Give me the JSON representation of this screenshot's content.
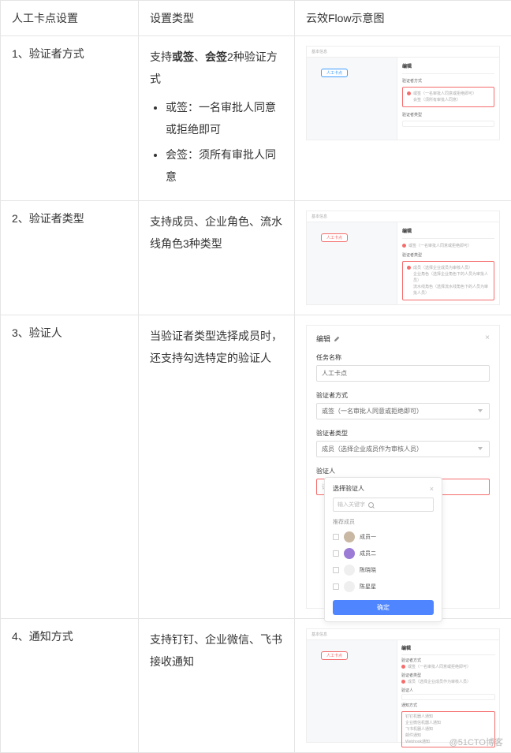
{
  "headers": {
    "col1": "人工卡点设置",
    "col2": "设置类型",
    "col3": "云效Flow示意图"
  },
  "rows": [
    {
      "num": "1、验证者方式",
      "desc_intro": "支持",
      "desc_b1": "或签",
      "desc_sep": "、",
      "desc_b2": "会签",
      "desc_tail": "2种验证方式",
      "bullets": [
        "或签：一名审批人同意或拒绝即可",
        "会签：须所有审批人同意"
      ],
      "diag": {
        "nav": "基本信息",
        "pill": "人工卡点",
        "panel_title": "编辑",
        "panel_section": "验证者方式",
        "opt1": "或签（一名审批人同意或拒绝即可）",
        "opt2": "会签（须所有审批人同意）",
        "panel_section2": "验证者类型"
      }
    },
    {
      "num": "2、验证者类型",
      "desc": "支持成员、企业角色、流水线角色3种类型",
      "diag": {
        "nav": "基本信息",
        "pill": "人工卡点",
        "panel_title": "编辑",
        "panel_opt_above": "或签（一名审批人同意或拒绝即可）",
        "panel_section": "验证者类型",
        "opt1": "成员（选择企业成员为审核人员）",
        "opt2": "企业角色（选择企业角色下的人员为审批人员）",
        "opt3": "流水线角色（选择流水线角色下的人员为审批人员）"
      }
    },
    {
      "num": "3、验证人",
      "desc": "当验证者类型选择成员时，还支持勾选特定的验证人",
      "diag": {
        "title": "编辑",
        "f1_label": "任务名称",
        "f1_value": "人工卡点",
        "f2_label": "验证者方式",
        "f2_value": "或签（一名审批人同意或拒绝即可）",
        "f3_label": "验证者类型",
        "f3_value": "成员（选择企业成员作为审核人员）",
        "f4_label": "验证人",
        "f4_placeholder": "请选择",
        "popup": {
          "title": "选择验证人",
          "search_placeholder": "输入关键字",
          "section": "推荐成员",
          "members": [
            "成员一",
            "成员二",
            "陈晓晓",
            "陈星星"
          ],
          "confirm": "确定"
        }
      }
    },
    {
      "num": "4、通知方式",
      "desc": "支持钉钉、企业微信、飞书接收通知",
      "diag": {
        "nav": "基本信息",
        "pill": "人工卡点",
        "panel_title": "编辑",
        "panel_section_a": "验证者方式",
        "panel_opt_a": "或签（一名审批人同意或拒绝即可）",
        "panel_section_b": "验证者类型",
        "panel_opt_b": "成员（选择企业成员作为审核人员）",
        "panel_section_c": "验证人",
        "panel_section_d": "通知方式",
        "opts": [
          "钉钉机器人通知",
          "企业微信机器人通知",
          "飞书机器人通知",
          "邮件通知",
          "Webhook通知"
        ]
      }
    }
  ],
  "watermark": "@51CTO博客"
}
